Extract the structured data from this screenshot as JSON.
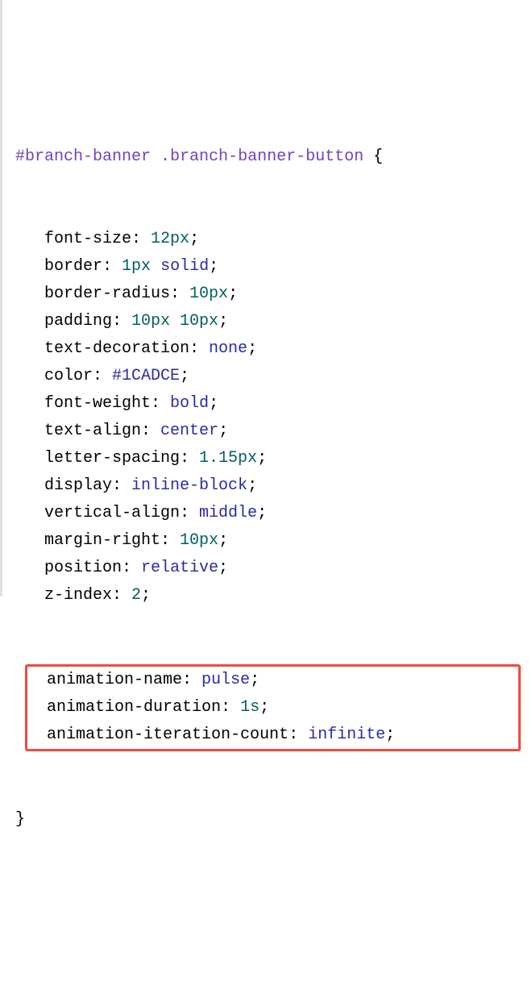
{
  "code": {
    "selector_id": "#branch-banner",
    "selector_class": ".branch-banner-button",
    "open_brace": "{",
    "close_brace": "}",
    "rules": [
      {
        "prop": "font-size",
        "val": "12px",
        "valclass": "num"
      },
      {
        "prop": "border",
        "val": "1px solid",
        "valclass": "num-kw"
      },
      {
        "prop": "border-radius",
        "val": "10px",
        "valclass": "num"
      },
      {
        "prop": "padding",
        "val": "10px 10px",
        "valclass": "num"
      },
      {
        "prop": "text-decoration",
        "val": "none",
        "valclass": "kw"
      },
      {
        "prop": "color",
        "val": "#1CADCE",
        "valclass": "hex"
      },
      {
        "prop": "font-weight",
        "val": "bold",
        "valclass": "kw"
      },
      {
        "prop": "text-align",
        "val": "center",
        "valclass": "kw"
      },
      {
        "prop": "letter-spacing",
        "val": "1.15px",
        "valclass": "num"
      },
      {
        "prop": "display",
        "val": "inline-block",
        "valclass": "kw"
      },
      {
        "prop": "vertical-align",
        "val": "middle",
        "valclass": "kw"
      },
      {
        "prop": "margin-right",
        "val": "10px",
        "valclass": "num"
      },
      {
        "prop": "position",
        "val": "relative",
        "valclass": "kw"
      },
      {
        "prop": "z-index",
        "val": "2",
        "valclass": "num"
      }
    ],
    "highlighted": [
      {
        "prop": "animation-name",
        "val": "pulse",
        "valclass": "kw"
      },
      {
        "prop": "animation-duration",
        "val": "1s",
        "valclass": "num"
      },
      {
        "prop": "animation-iteration-count",
        "val": "infinite",
        "valclass": "kw"
      }
    ]
  }
}
